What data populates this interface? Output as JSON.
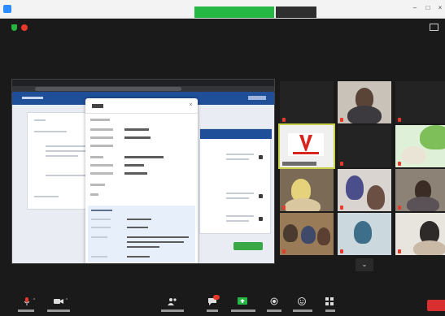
{
  "window": {
    "title": "",
    "share_banner": "",
    "view_options": ""
  },
  "meeting": {
    "recording_label": ""
  },
  "participants": [
    {
      "name": ""
    },
    {
      "name": ""
    },
    {
      "name": ""
    },
    {
      "name": ""
    }
  ],
  "toolbar": {
    "end_label": ""
  },
  "colors": {
    "share_banner": "#25b845",
    "app_header": "#1f4f99",
    "end_button": "#d82f2f",
    "active_speaker_outline": "#c8d34a",
    "logo_red": "#d8231f"
  },
  "icons": [
    "zoom-app-icon",
    "shield-icon",
    "record-icon",
    "grid-view-icon",
    "microphone-icon",
    "video-camera-icon",
    "participants-icon",
    "chat-icon",
    "share-screen-icon",
    "record-button-icon",
    "reactions-icon",
    "apps-icon",
    "chevron-down-icon",
    "close-icon"
  ]
}
